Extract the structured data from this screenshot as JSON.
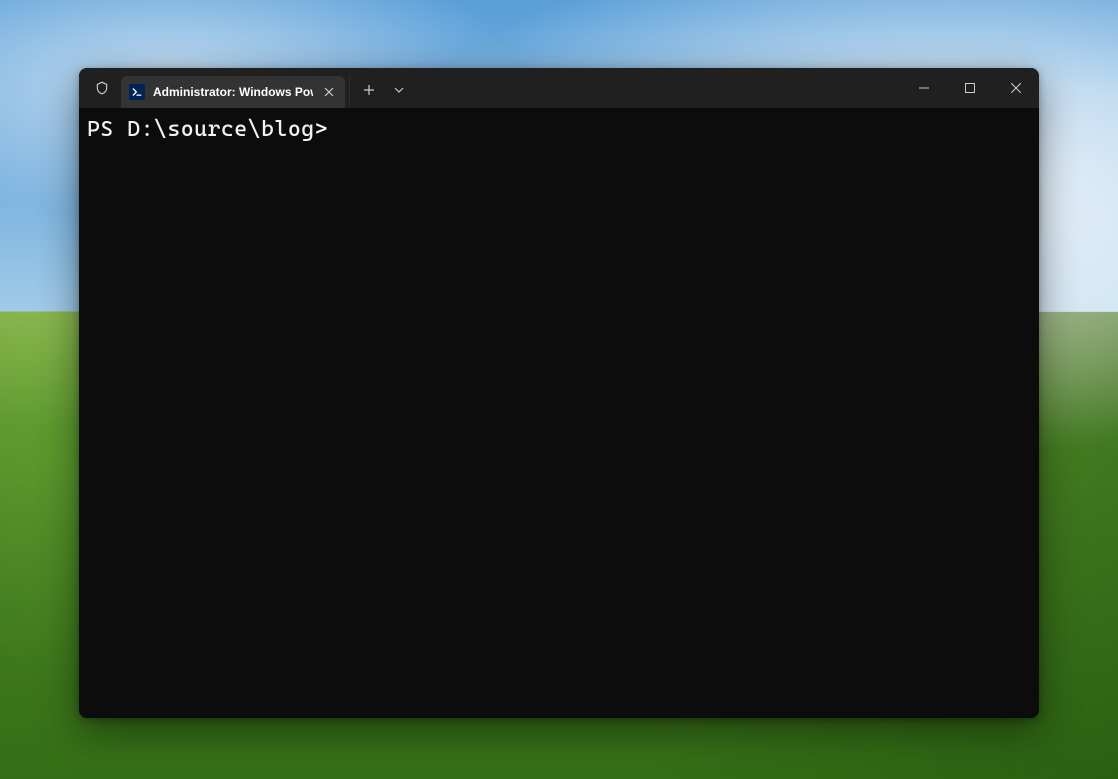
{
  "window": {
    "tab": {
      "title": "Administrator: Windows PowerShell",
      "icon_name": "powershell-icon"
    },
    "admin_shield": "shield-icon",
    "controls": {
      "minimize": "minimize-icon",
      "maximize": "maximize-icon",
      "close": "close-icon"
    }
  },
  "terminal": {
    "prompt": "PS D:\\source\\blog> "
  }
}
